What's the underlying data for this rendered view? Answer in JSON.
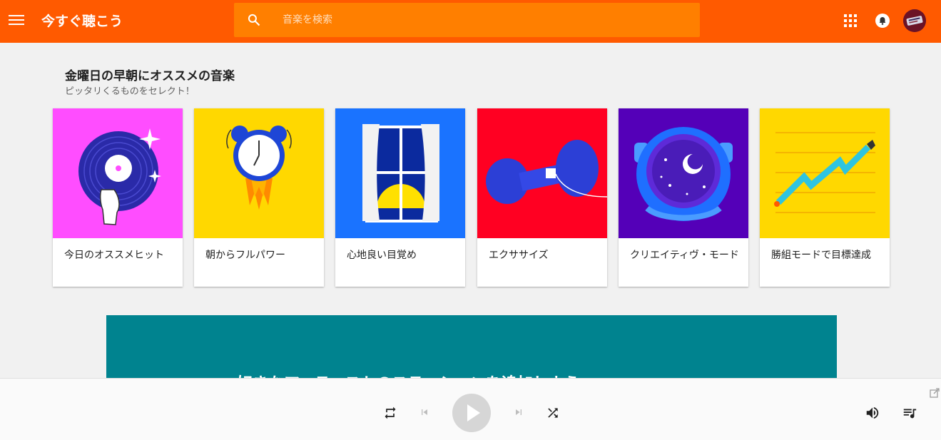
{
  "header": {
    "title": "今すぐ聴こう",
    "search_placeholder": "音楽を検索",
    "colors": {
      "header_bg": "#ff5a00",
      "search_bg": "#ff7f00"
    },
    "icons": [
      "menu-icon",
      "search-icon",
      "apps-grid-icon",
      "notification-bell-icon",
      "user-avatar"
    ]
  },
  "section": {
    "title": "金曜日の早朝にオススメの音楽",
    "subtitle": "ピッタリくるものをセレクト！"
  },
  "cards": [
    {
      "label": "今日のオススメヒット",
      "bg": "#ff4dff",
      "icon": "vinyl-record-icon"
    },
    {
      "label": "朝からフルパワー",
      "bg": "#ffd800",
      "icon": "alarm-clock-rocket-icon"
    },
    {
      "label": "心地良い目覚め",
      "bg": "#1a73ff",
      "icon": "window-sunrise-icon"
    },
    {
      "label": "エクササイズ",
      "bg": "#ff0022",
      "icon": "dumbbell-icon"
    },
    {
      "label": "クリエイティヴ・モード",
      "bg": "#5400b8",
      "icon": "astronaut-helmet-icon"
    },
    {
      "label": "勝組モードで目標達成",
      "bg": "#ffd800",
      "icon": "pencil-graph-icon"
    }
  ],
  "banner": {
    "text": "好きなアーティストのステーションを追加しよう",
    "bg": "#00838f"
  },
  "player": {
    "icons": [
      "repeat-icon",
      "skip-previous-icon",
      "play-icon",
      "skip-next-icon",
      "shuffle-icon",
      "volume-icon",
      "queue-icon",
      "open-in-new-icon"
    ]
  }
}
